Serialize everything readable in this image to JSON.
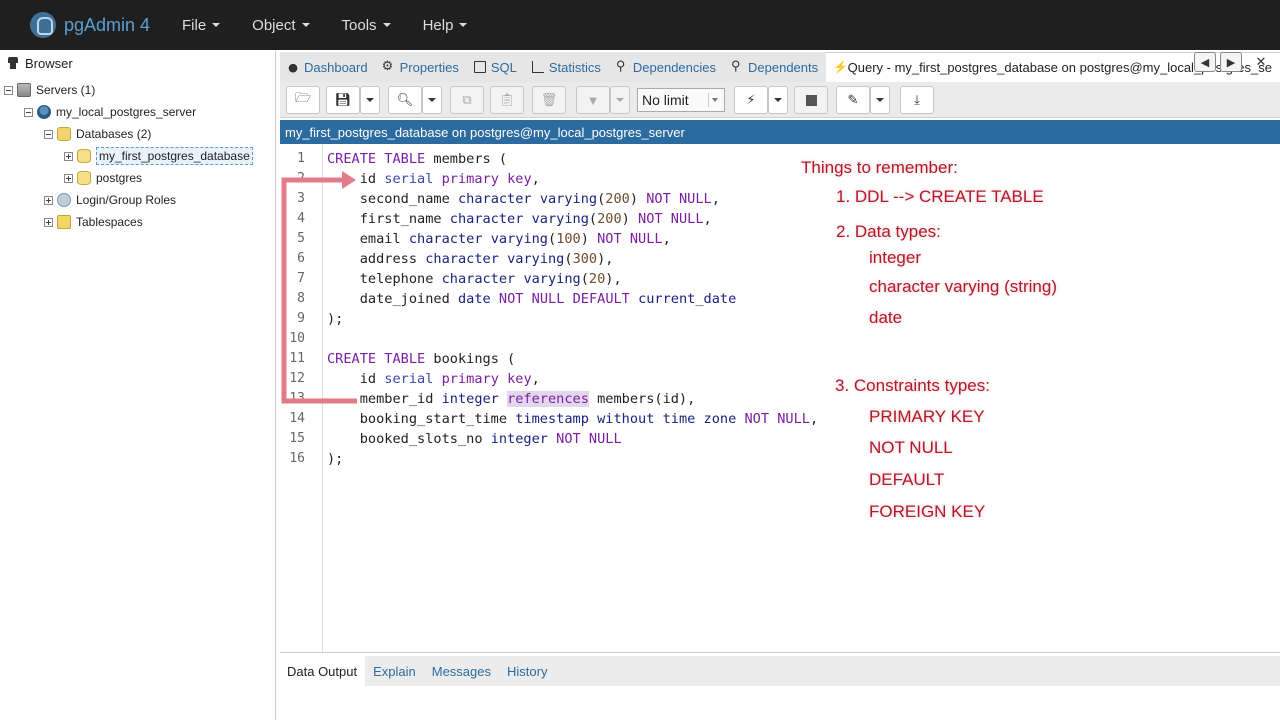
{
  "app": {
    "name": "pgAdmin 4"
  },
  "menu": [
    {
      "label": "File"
    },
    {
      "label": "Object"
    },
    {
      "label": "Tools"
    },
    {
      "label": "Help"
    }
  ],
  "browser": {
    "title": "Browser",
    "tree": [
      {
        "label": "Servers (1)"
      },
      {
        "label": "my_local_postgres_server"
      },
      {
        "label": "Databases (2)"
      },
      {
        "label": "my_first_postgres_database"
      },
      {
        "label": "postgres"
      },
      {
        "label": "Login/Group Roles"
      },
      {
        "label": "Tablespaces"
      }
    ]
  },
  "tabs": [
    {
      "label": "Dashboard"
    },
    {
      "label": "Properties"
    },
    {
      "label": "SQL"
    },
    {
      "label": "Statistics"
    },
    {
      "label": "Dependencies"
    },
    {
      "label": "Dependents"
    },
    {
      "label": "Query - my_first_postgres_database on postgres@my_local_postgres_se"
    }
  ],
  "toolbar": {
    "limit_value": "No limit"
  },
  "connection": "my_first_postgres_database on postgres@my_local_postgres_server",
  "editor": {
    "line_numbers": [
      "1",
      "2",
      "3",
      "4",
      "5",
      "6",
      "7",
      "8",
      "9",
      "10",
      "11",
      "12",
      "13",
      "14",
      "15",
      "16"
    ]
  },
  "notes": {
    "title": "Things to remember:",
    "item1": "1. DDL --> CREATE TABLE",
    "item2": "2. Data types:",
    "dt1": "integer",
    "dt2": "character varying (string)",
    "dt3": "date",
    "item3": "3. Constraints types:",
    "c1": "PRIMARY KEY",
    "c2": "NOT NULL",
    "c3": "DEFAULT",
    "c4": "FOREIGN KEY"
  },
  "bottom_tabs": [
    {
      "label": "Data Output"
    },
    {
      "label": "Explain"
    },
    {
      "label": "Messages"
    },
    {
      "label": "History"
    }
  ],
  "colors": {
    "topbar": "#1f1f1f",
    "accent": "#2c6ba0",
    "annotation": "#b3192c",
    "arrow": "#e27a88"
  }
}
